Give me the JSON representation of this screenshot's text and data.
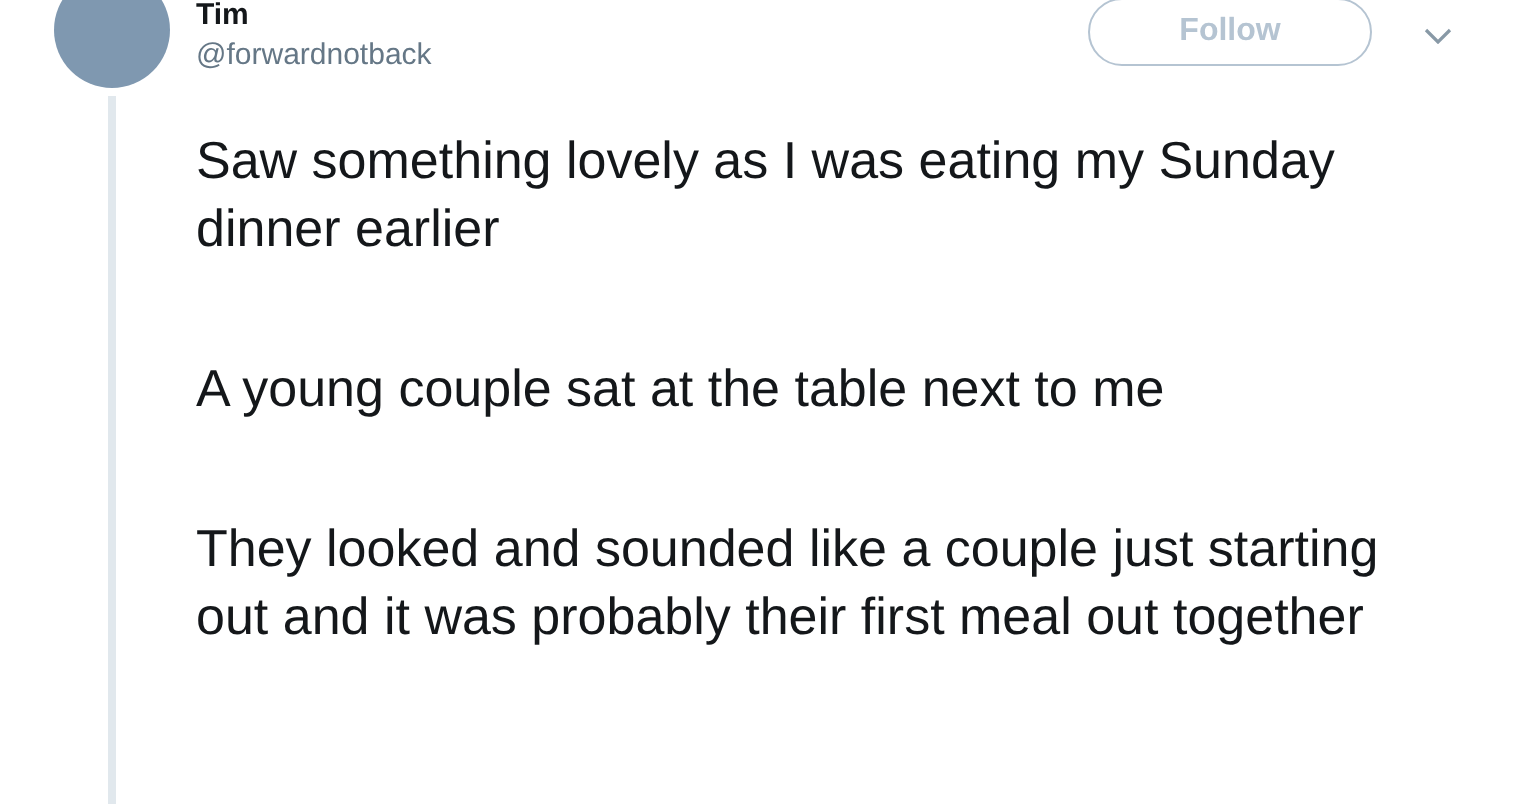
{
  "author": {
    "name": "Tim",
    "handle": "@forwardnotback"
  },
  "follow_button": {
    "label": "Follow"
  },
  "paragraphs": [
    "Saw something lovely as I was eating my Sunday dinner earlier",
    "A young couple sat at the table next to me",
    "They looked and sounded like a couple just starting out and it was probably their first meal out together"
  ]
}
